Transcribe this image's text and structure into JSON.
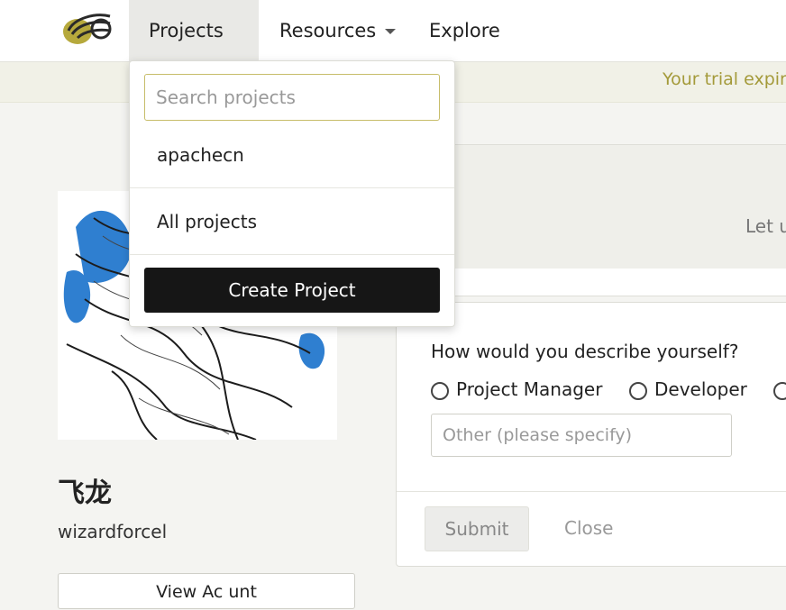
{
  "nav": {
    "logo_name": "site-logo",
    "items": [
      {
        "label": "Projects",
        "has_caret": true,
        "active": true
      },
      {
        "label": "Resources",
        "has_caret": true,
        "active": false
      },
      {
        "label": "Explore",
        "has_caret": false,
        "active": false
      }
    ]
  },
  "banner": {
    "text": "Your trial expire"
  },
  "dropdown": {
    "search_placeholder": "Search projects",
    "projects": [
      "apachecn"
    ],
    "all_projects_label": "All projects",
    "create_label": "Create Project"
  },
  "profile": {
    "display_name": "飞龙",
    "username": "wizardforcel",
    "button_label": "View Ac  unt"
  },
  "card": {
    "partial_text": "Let u"
  },
  "survey": {
    "question": "How would you describe yourself?",
    "options": [
      "Project Manager",
      "Developer",
      ""
    ],
    "other_placeholder": "Other (please specify)",
    "submit_label": "Submit",
    "close_label": "Close"
  },
  "colors": {
    "accent_gold": "#a49a3a",
    "dark_button": "#161616"
  }
}
